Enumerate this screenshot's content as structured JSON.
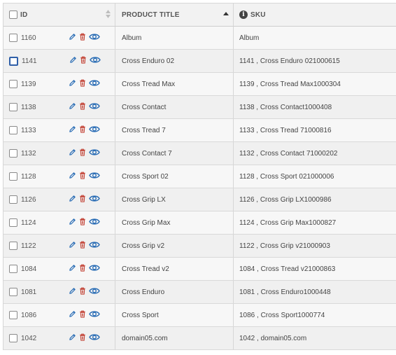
{
  "header": {
    "id_label": "ID",
    "title_label": "PRODUCT TITLE",
    "sku_label": "SKU"
  },
  "colors": {
    "edit": "#2a6db5",
    "delete": "#c0392b",
    "view": "#2a6db5"
  },
  "rows": [
    {
      "id": "1160",
      "title": "Album",
      "sku": "Album"
    },
    {
      "id": "1141",
      "title": "Cross Enduro 02",
      "sku": "1141 , Cross Enduro 021000615"
    },
    {
      "id": "1139",
      "title": "Cross Tread Max",
      "sku": "1139 , Cross Tread Max1000304"
    },
    {
      "id": "1138",
      "title": "Cross Contact",
      "sku": "1138 , Cross Contact1000408"
    },
    {
      "id": "1133",
      "title": "Cross Tread 7",
      "sku": "1133 , Cross Tread 71000816"
    },
    {
      "id": "1132",
      "title": "Cross Contact 7",
      "sku": "1132 , Cross Contact 71000202"
    },
    {
      "id": "1128",
      "title": "Cross Sport 02",
      "sku": "1128 , Cross Sport 021000006"
    },
    {
      "id": "1126",
      "title": "Cross Grip LX",
      "sku": "1126 , Cross Grip LX1000986"
    },
    {
      "id": "1124",
      "title": "Cross Grip Max",
      "sku": "1124 , Cross Grip Max1000827"
    },
    {
      "id": "1122",
      "title": "Cross Grip v2",
      "sku": "1122 , Cross Grip v21000903"
    },
    {
      "id": "1084",
      "title": "Cross Tread v2",
      "sku": "1084 , Cross Tread v21000863"
    },
    {
      "id": "1081",
      "title": "Cross Enduro",
      "sku": "1081 , Cross Enduro1000448"
    },
    {
      "id": "1086",
      "title": "Cross Sport",
      "sku": "1086 , Cross Sport1000774"
    },
    {
      "id": "1042",
      "title": "domain05.com",
      "sku": "1042 , domain05.com"
    }
  ]
}
